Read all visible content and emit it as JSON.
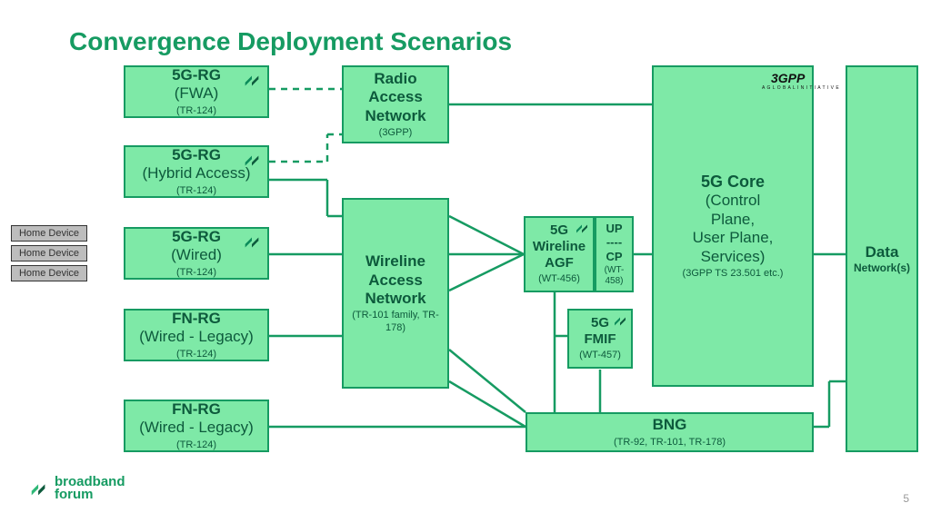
{
  "title": "Convergence Deployment Scenarios",
  "page_number": "5",
  "home_devices": [
    "Home Device",
    "Home Device",
    "Home Device"
  ],
  "boxes": {
    "rg_fwa": {
      "line1": "5G-RG",
      "line2": "(FWA)",
      "line3": "(TR-124)"
    },
    "rg_hybrid": {
      "line1": "5G-RG",
      "line2": "(Hybrid Access)",
      "line3": "(TR-124)"
    },
    "rg_wired": {
      "line1": "5G-RG",
      "line2": "(Wired)",
      "line3": "(TR-124)"
    },
    "fn_rg_1": {
      "line1": "FN-RG",
      "line2": "(Wired - Legacy)",
      "line3": "(TR-124)"
    },
    "fn_rg_2": {
      "line1": "FN-RG",
      "line2": "(Wired - Legacy)",
      "line3": "(TR-124)"
    },
    "ran": {
      "line1": "Radio",
      "line2a": "Access",
      "line2b": "Network",
      "line3": "(3GPP)"
    },
    "wireline": {
      "line1": "Wireline",
      "line2a": "Access",
      "line2b": "Network",
      "line3": "(TR-101 family, TR-178)"
    },
    "agf": {
      "line1": "5G",
      "line2a": "Wireline",
      "line2b": "AGF",
      "line3": "(WT-456)"
    },
    "up_cp": {
      "line_up": "UP",
      "dash": "----",
      "line_cp": "CP",
      "line3": "(WT-458)"
    },
    "fmif": {
      "line1": "5G",
      "line2": "FMIF",
      "line3": "(WT-457)"
    },
    "core": {
      "line1": "5G Core",
      "line2a": "(Control",
      "line2b": "Plane,",
      "line2c": "User Plane,",
      "line2d": "Services)",
      "line3": "(3GPP TS 23.501 etc.)"
    },
    "bng": {
      "line1": "BNG",
      "line3": "(TR-92, TR-101, TR-178)"
    },
    "data": {
      "line1": "Data",
      "line2": "Network(s)"
    }
  },
  "logos": {
    "broadband_forum": {
      "line1": "broadband",
      "line2": "forum"
    },
    "three_gpp": {
      "text": "3GPP",
      "sub": "A   G L O B A L   I N I T I A T I V E"
    }
  }
}
